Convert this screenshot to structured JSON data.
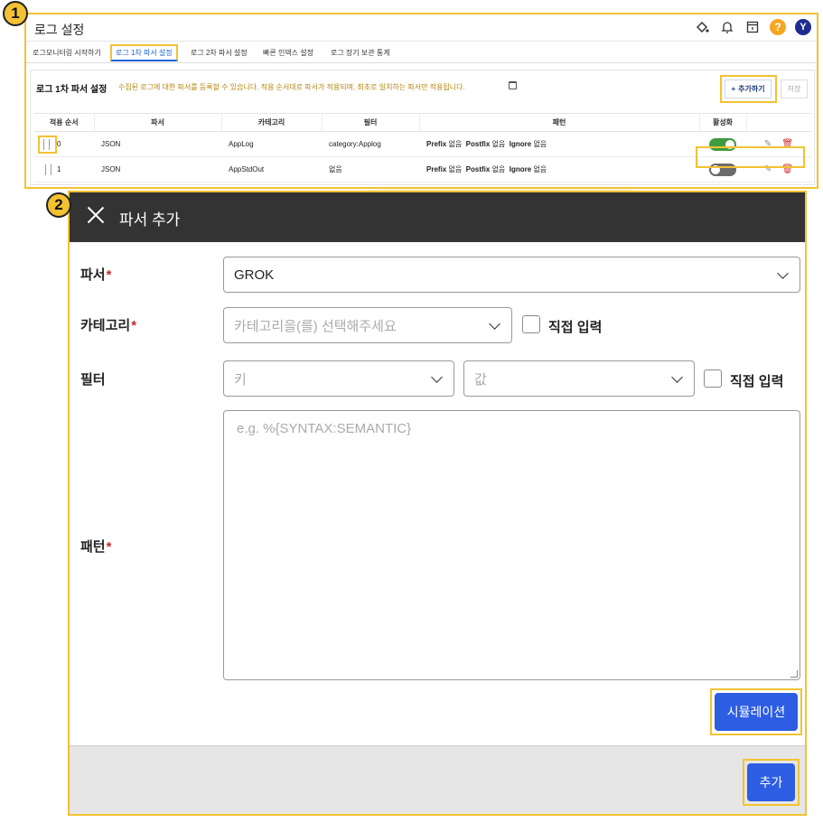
{
  "badges": {
    "one": "1",
    "two": "2"
  },
  "app": {
    "title": "로그 설정"
  },
  "tabs": [
    {
      "label": "로그모니터링 시작하기"
    },
    {
      "label": "로그 1차 파서 설정"
    },
    {
      "label": "로그 2차 파서 설정"
    },
    {
      "label": "빠른 인덱스 설정"
    },
    {
      "label": "로그 장기 보관 통계"
    }
  ],
  "user": {
    "avatar": "Y"
  },
  "section": {
    "title": "로그 1차 파서 설정",
    "description": "수집된 로그에 대한 파서를 등록할 수 있습니다. 적용 순서대로 파서가 적용되며, 최초로 일치하는 파서만 적용됩니다.",
    "add_button": "추가하기",
    "save_button": "저장"
  },
  "table": {
    "headers": [
      "적용 순서",
      "파서",
      "카테고리",
      "필터",
      "패턴",
      "활성화",
      ""
    ],
    "rows": [
      {
        "order": "0",
        "parser": "JSON",
        "category": "AppLog",
        "filter": "category:Applog",
        "prefix_label": "Prefix",
        "prefix_val": "없음",
        "postfix_label": "Postfix",
        "postfix_val": "없음",
        "ignore_label": "Ignore",
        "ignore_val": "없음",
        "enabled": true
      },
      {
        "order": "1",
        "parser": "JSON",
        "category": "AppStdOut",
        "filter": "없음",
        "prefix_label": "Prefix",
        "prefix_val": "없음",
        "postfix_label": "Postfix",
        "postfix_val": "없음",
        "ignore_label": "Ignore",
        "ignore_val": "없음",
        "enabled": false
      }
    ]
  },
  "modal": {
    "title": "파서 추가",
    "parser_label": "파서",
    "parser_value": "GROK",
    "category_label": "카테고리",
    "category_placeholder": "카테고리을(를) 선택해주세요",
    "direct_input": "직접 입력",
    "filter_label": "필터",
    "filter_key_placeholder": "키",
    "filter_value_placeholder": "값",
    "pattern_label": "패턴",
    "pattern_placeholder": "e.g. %{SYNTAX:SEMANTIC}",
    "simulate_button": "시뮬레이션",
    "submit_button": "추가",
    "required_mark": "*"
  },
  "colors": {
    "highlight": "#f2c233",
    "primary": "#2d5de3",
    "header_bg": "#333333",
    "toggle_on": "#3f9b3f"
  },
  "icons": [
    "paint-bucket-icon",
    "bell-icon",
    "calendar-icon",
    "help-icon",
    "calendar-small-icon",
    "plus-icon",
    "drag-handle-icon",
    "edit-icon",
    "delete-icon",
    "close-icon",
    "chevron-down-icon"
  ]
}
